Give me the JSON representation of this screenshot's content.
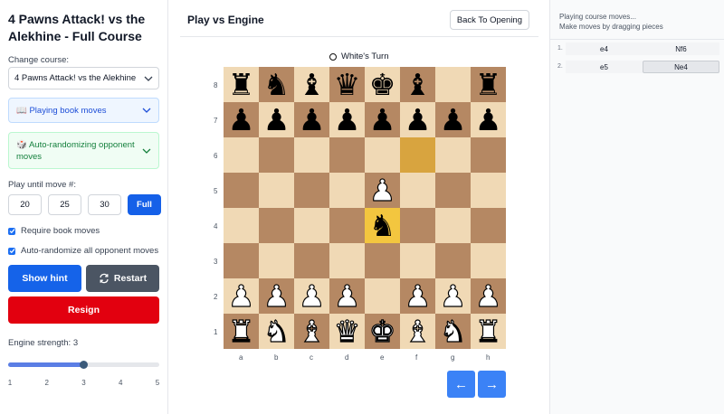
{
  "sidebar": {
    "course_title": "4 Pawns Attack! vs the Alekhine - Full Course",
    "change_course_label": "Change course:",
    "course_select_value": "4 Pawns Attack! vs the Alekhine",
    "book_panel_label": "📖 Playing book moves",
    "random_panel_label": "🎲 Auto-randomizing opponent moves",
    "play_until_label": "Play until move #:",
    "move_options": [
      "20",
      "25",
      "30",
      "Full"
    ],
    "selected_move_option": "Full",
    "require_book_label": "Require book moves",
    "require_book_checked": true,
    "auto_randomize_label": "Auto-randomize all opponent moves",
    "auto_randomize_checked": true,
    "hint_label": "Show hint",
    "restart_label": "Restart",
    "resign_label": "Resign",
    "engine_strength_label": "Engine strength: 3",
    "engine_strength": 3,
    "strength_ticks": [
      "1",
      "2",
      "3",
      "4",
      "5"
    ]
  },
  "center": {
    "title": "Play vs Engine",
    "back_label": "Back To Opening",
    "turn_text": "White's Turn",
    "nav_prev": "←",
    "nav_next": "→"
  },
  "board": {
    "ranks": [
      "8",
      "7",
      "6",
      "5",
      "4",
      "3",
      "2",
      "1"
    ],
    "files": [
      "a",
      "b",
      "c",
      "d",
      "e",
      "f",
      "g",
      "h"
    ],
    "rows": [
      [
        "r",
        "n",
        "b",
        "q",
        "k",
        "b",
        "",
        "r"
      ],
      [
        "p",
        "p",
        "p",
        "p",
        "p",
        "p",
        "p",
        "p"
      ],
      [
        "",
        "",
        "",
        "",
        "",
        "",
        "",
        ""
      ],
      [
        "",
        "",
        "",
        "",
        "P",
        "",
        "",
        ""
      ],
      [
        "",
        "",
        "",
        "",
        "n",
        "",
        "",
        ""
      ],
      [
        "",
        "",
        "",
        "",
        "",
        "",
        "",
        ""
      ],
      [
        "P",
        "P",
        "P",
        "P",
        "",
        "P",
        "P",
        "P"
      ],
      [
        "R",
        "N",
        "B",
        "Q",
        "K",
        "B",
        "N",
        "R"
      ]
    ],
    "last_move_from": "f6",
    "last_move_to": "e4"
  },
  "moves_panel": {
    "info_line1": "Playing course moves...",
    "info_line2": "Make moves by dragging pieces",
    "moves": [
      {
        "num": "1.",
        "white": "e4",
        "black": "Nf6"
      },
      {
        "num": "2.",
        "white": "e5",
        "black": "Ne4"
      }
    ]
  },
  "colors": {
    "light_square": "#f0d9b5",
    "dark_square": "#b58863",
    "primary": "#1563e9",
    "danger": "#e2000f"
  }
}
